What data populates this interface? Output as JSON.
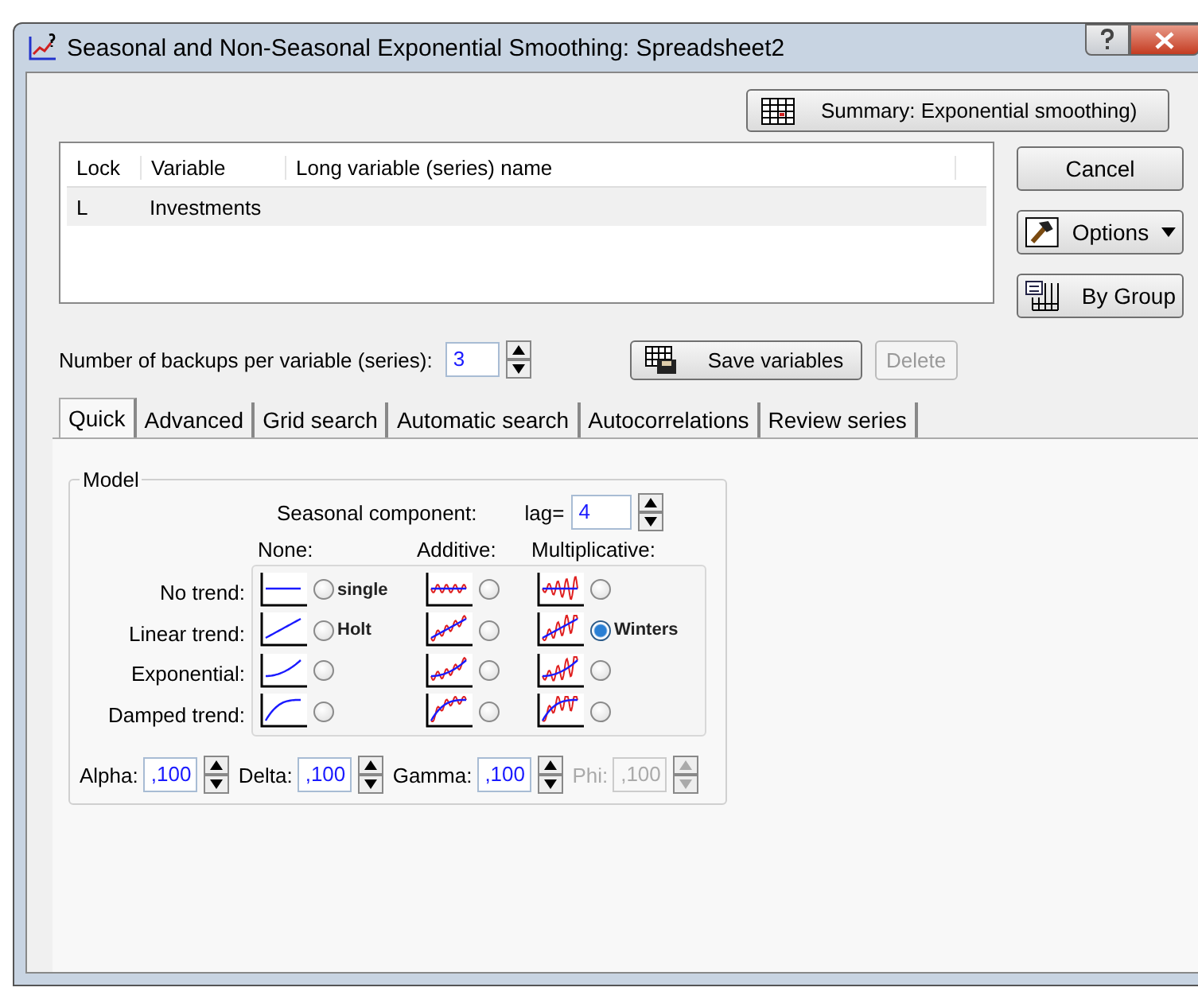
{
  "window": {
    "title": "Seasonal and Non-Seasonal Exponential Smoothing: Spreadsheet2"
  },
  "summary_button": "Summary:  Exponential smoothing)",
  "variables_table": {
    "columns": [
      "Lock",
      "Variable",
      "Long variable (series) name"
    ],
    "rows": [
      {
        "cells": [
          "L",
          "Investments"
        ]
      }
    ]
  },
  "side_buttons": [
    {
      "label": "Cancel",
      "kind": "plain"
    },
    {
      "label": "Options",
      "kind": "menu"
    },
    {
      "label": "By Group",
      "kind": "group"
    }
  ],
  "backups": {
    "label": "Number of backups per variable (series):",
    "value": "3"
  },
  "actions": [
    {
      "label": "Save variables",
      "kind": "save",
      "disabled": false
    },
    {
      "label": "Delete",
      "kind": "plain",
      "disabled": true
    }
  ],
  "tabs": [
    {
      "label": "Quick",
      "selected": true
    },
    {
      "label": "Advanced",
      "selected": false
    },
    {
      "label": "Grid search",
      "selected": false
    },
    {
      "label": "Automatic search",
      "selected": false
    },
    {
      "label": "Autocorrelations",
      "selected": false
    },
    {
      "label": "Review series",
      "selected": false
    }
  ],
  "model": {
    "title": "Model",
    "seasonal_label": "Seasonal component:",
    "lag_label": "lag=",
    "lag_value": "4",
    "column_headers": [
      "None:",
      "Additive:",
      "Multiplicative:"
    ],
    "rows": [
      {
        "label": "No trend:",
        "options": [
          {
            "selected": false,
            "text": "single"
          },
          {
            "selected": false
          },
          {
            "selected": false
          }
        ]
      },
      {
        "label": "Linear trend:",
        "options": [
          {
            "selected": false,
            "text": "Holt"
          },
          {
            "selected": false
          },
          {
            "selected": true,
            "text": "Winters"
          }
        ]
      },
      {
        "label": "Exponential:",
        "options": [
          {
            "selected": false
          },
          {
            "selected": false
          },
          {
            "selected": false
          }
        ]
      },
      {
        "label": "Damped trend:",
        "options": [
          {
            "selected": false
          },
          {
            "selected": false
          },
          {
            "selected": false
          }
        ]
      }
    ],
    "parameters": [
      {
        "label": "Alpha:",
        "value": ",100",
        "disabled": false
      },
      {
        "label": "Delta:",
        "value": ",100",
        "disabled": false
      },
      {
        "label": "Gamma:",
        "value": ",100",
        "disabled": false
      },
      {
        "label": "Phi:",
        "value": ",100",
        "disabled": true
      }
    ]
  }
}
